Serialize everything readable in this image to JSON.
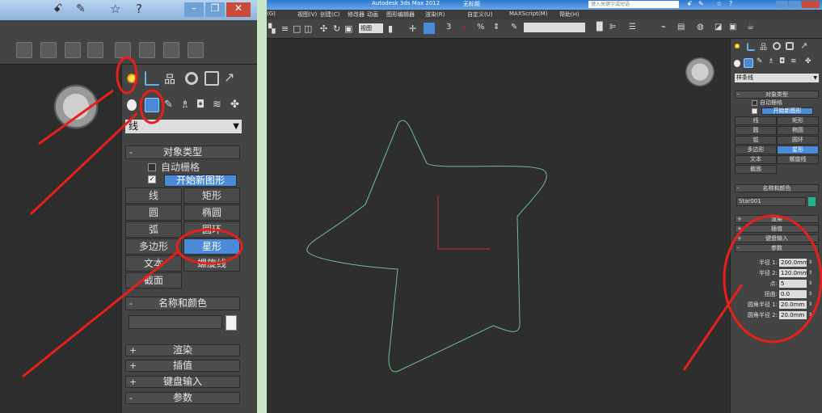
{
  "left_panel": {
    "title_icons": [
      "binoculars-icon",
      "tools-icon",
      "star-icon",
      "help-icon"
    ],
    "dropdown_value": "样条线",
    "dropdown_value_visible": "线",
    "rollout_object_type": {
      "title": "对象类型",
      "auto_grid_label": "自动栅格",
      "start_new_shape_label": "开始新图形",
      "buttons": [
        "线",
        "矩形",
        "圆",
        "椭圆",
        "弧",
        "圆环",
        "多边形",
        "星形",
        "文本",
        "螺旋线",
        "截面"
      ]
    },
    "rollout_name_color": {
      "title": "名称和颜色"
    },
    "collapsed_rollouts": [
      "渲染",
      "插值",
      "键盘输入"
    ],
    "rollout_parameters": {
      "title": "参数"
    }
  },
  "right_panel": {
    "title": "Autodesk 3ds Max  2012",
    "title_suffix": "无标题",
    "search_placeholder": "键入关键字或短语",
    "menu": [
      "(G)",
      "视图(V)",
      "创建(C)",
      "修改器",
      "动画",
      "图形编辑器",
      "渲染(R)",
      "自定义(U)",
      "MAXScript(M)",
      "帮助(H)"
    ],
    "toolbar_view_dropdown": "视图",
    "toolbar_numbers": [
      "3",
      "%"
    ],
    "cmd_panel": {
      "dropdown_value": "样条线",
      "rollout_object_type": {
        "title": "对象类型",
        "auto_grid_label": "自动栅格",
        "start_new_shape_label": "开始新图形",
        "buttons": [
          "线",
          "矩形",
          "圆",
          "椭圆",
          "弧",
          "圆环",
          "多边形",
          "星形",
          "文本",
          "螺旋线",
          "截面"
        ]
      },
      "rollout_name_color": {
        "title": "名称和颜色",
        "object_name": "Star001"
      },
      "collapsed_rollouts": [
        "渲染",
        "插值",
        "键盘输入"
      ],
      "parameters": {
        "title": "参数",
        "rows": [
          {
            "label": "半径 1:",
            "value": "200.0mm"
          },
          {
            "label": "半径 2:",
            "value": "120.0mm"
          },
          {
            "label": "点:",
            "value": "5"
          },
          {
            "label": "扭曲:",
            "value": "0.0"
          },
          {
            "label": "圆角半径 1:",
            "value": "20.0mm"
          },
          {
            "label": "圆角半径 2:",
            "value": "20.0mm"
          }
        ]
      }
    }
  },
  "colors": {
    "annotation_red": "#e8201a",
    "selected_blue": "#4a8ad8",
    "spline_green": "#6bc28a",
    "object_swatch": "#1fb58a",
    "separator_green": "#c9e6c9"
  }
}
